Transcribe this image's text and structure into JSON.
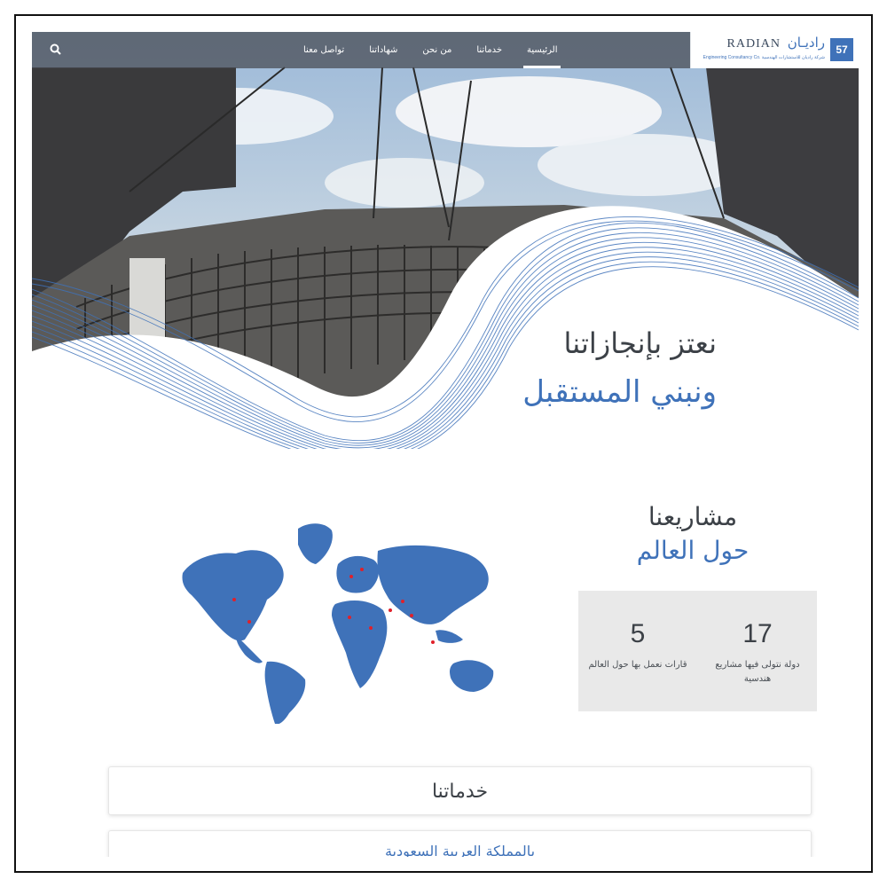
{
  "colors": {
    "brand": "#3f72b9",
    "text_dark": "#3c4147",
    "stats_bg": "#e9e9e9",
    "map_dot": "#e0202a"
  },
  "logo": {
    "en": "RADIAN",
    "ar": "راديـان",
    "badge": "57",
    "subtitle": "Engineering Consultancy Co. شركة راديان للاستشارات الهندسية"
  },
  "nav": {
    "items": [
      {
        "label": "الرئيسية",
        "active": true
      },
      {
        "label": "خدماتنا",
        "active": false
      },
      {
        "label": "من نحن",
        "active": false
      },
      {
        "label": "شهاداتنا",
        "active": false
      },
      {
        "label": "تواصل معنا",
        "active": false
      }
    ],
    "search_icon": "search-icon"
  },
  "hero": {
    "line1": "نعتز بإنجازاتنا",
    "line2": "ونبني المستقبل"
  },
  "projects": {
    "title1": "مشاريعنا",
    "title2": "حول العالم",
    "stats": [
      {
        "value": "17",
        "label": "دولة نتولى فيها مشاريع هندسية"
      },
      {
        "value": "5",
        "label": "قارات نعمل بها حول العالم"
      }
    ]
  },
  "services": {
    "title": "خدماتنا",
    "subtitle": "بالمملكة العربية السعودية"
  }
}
